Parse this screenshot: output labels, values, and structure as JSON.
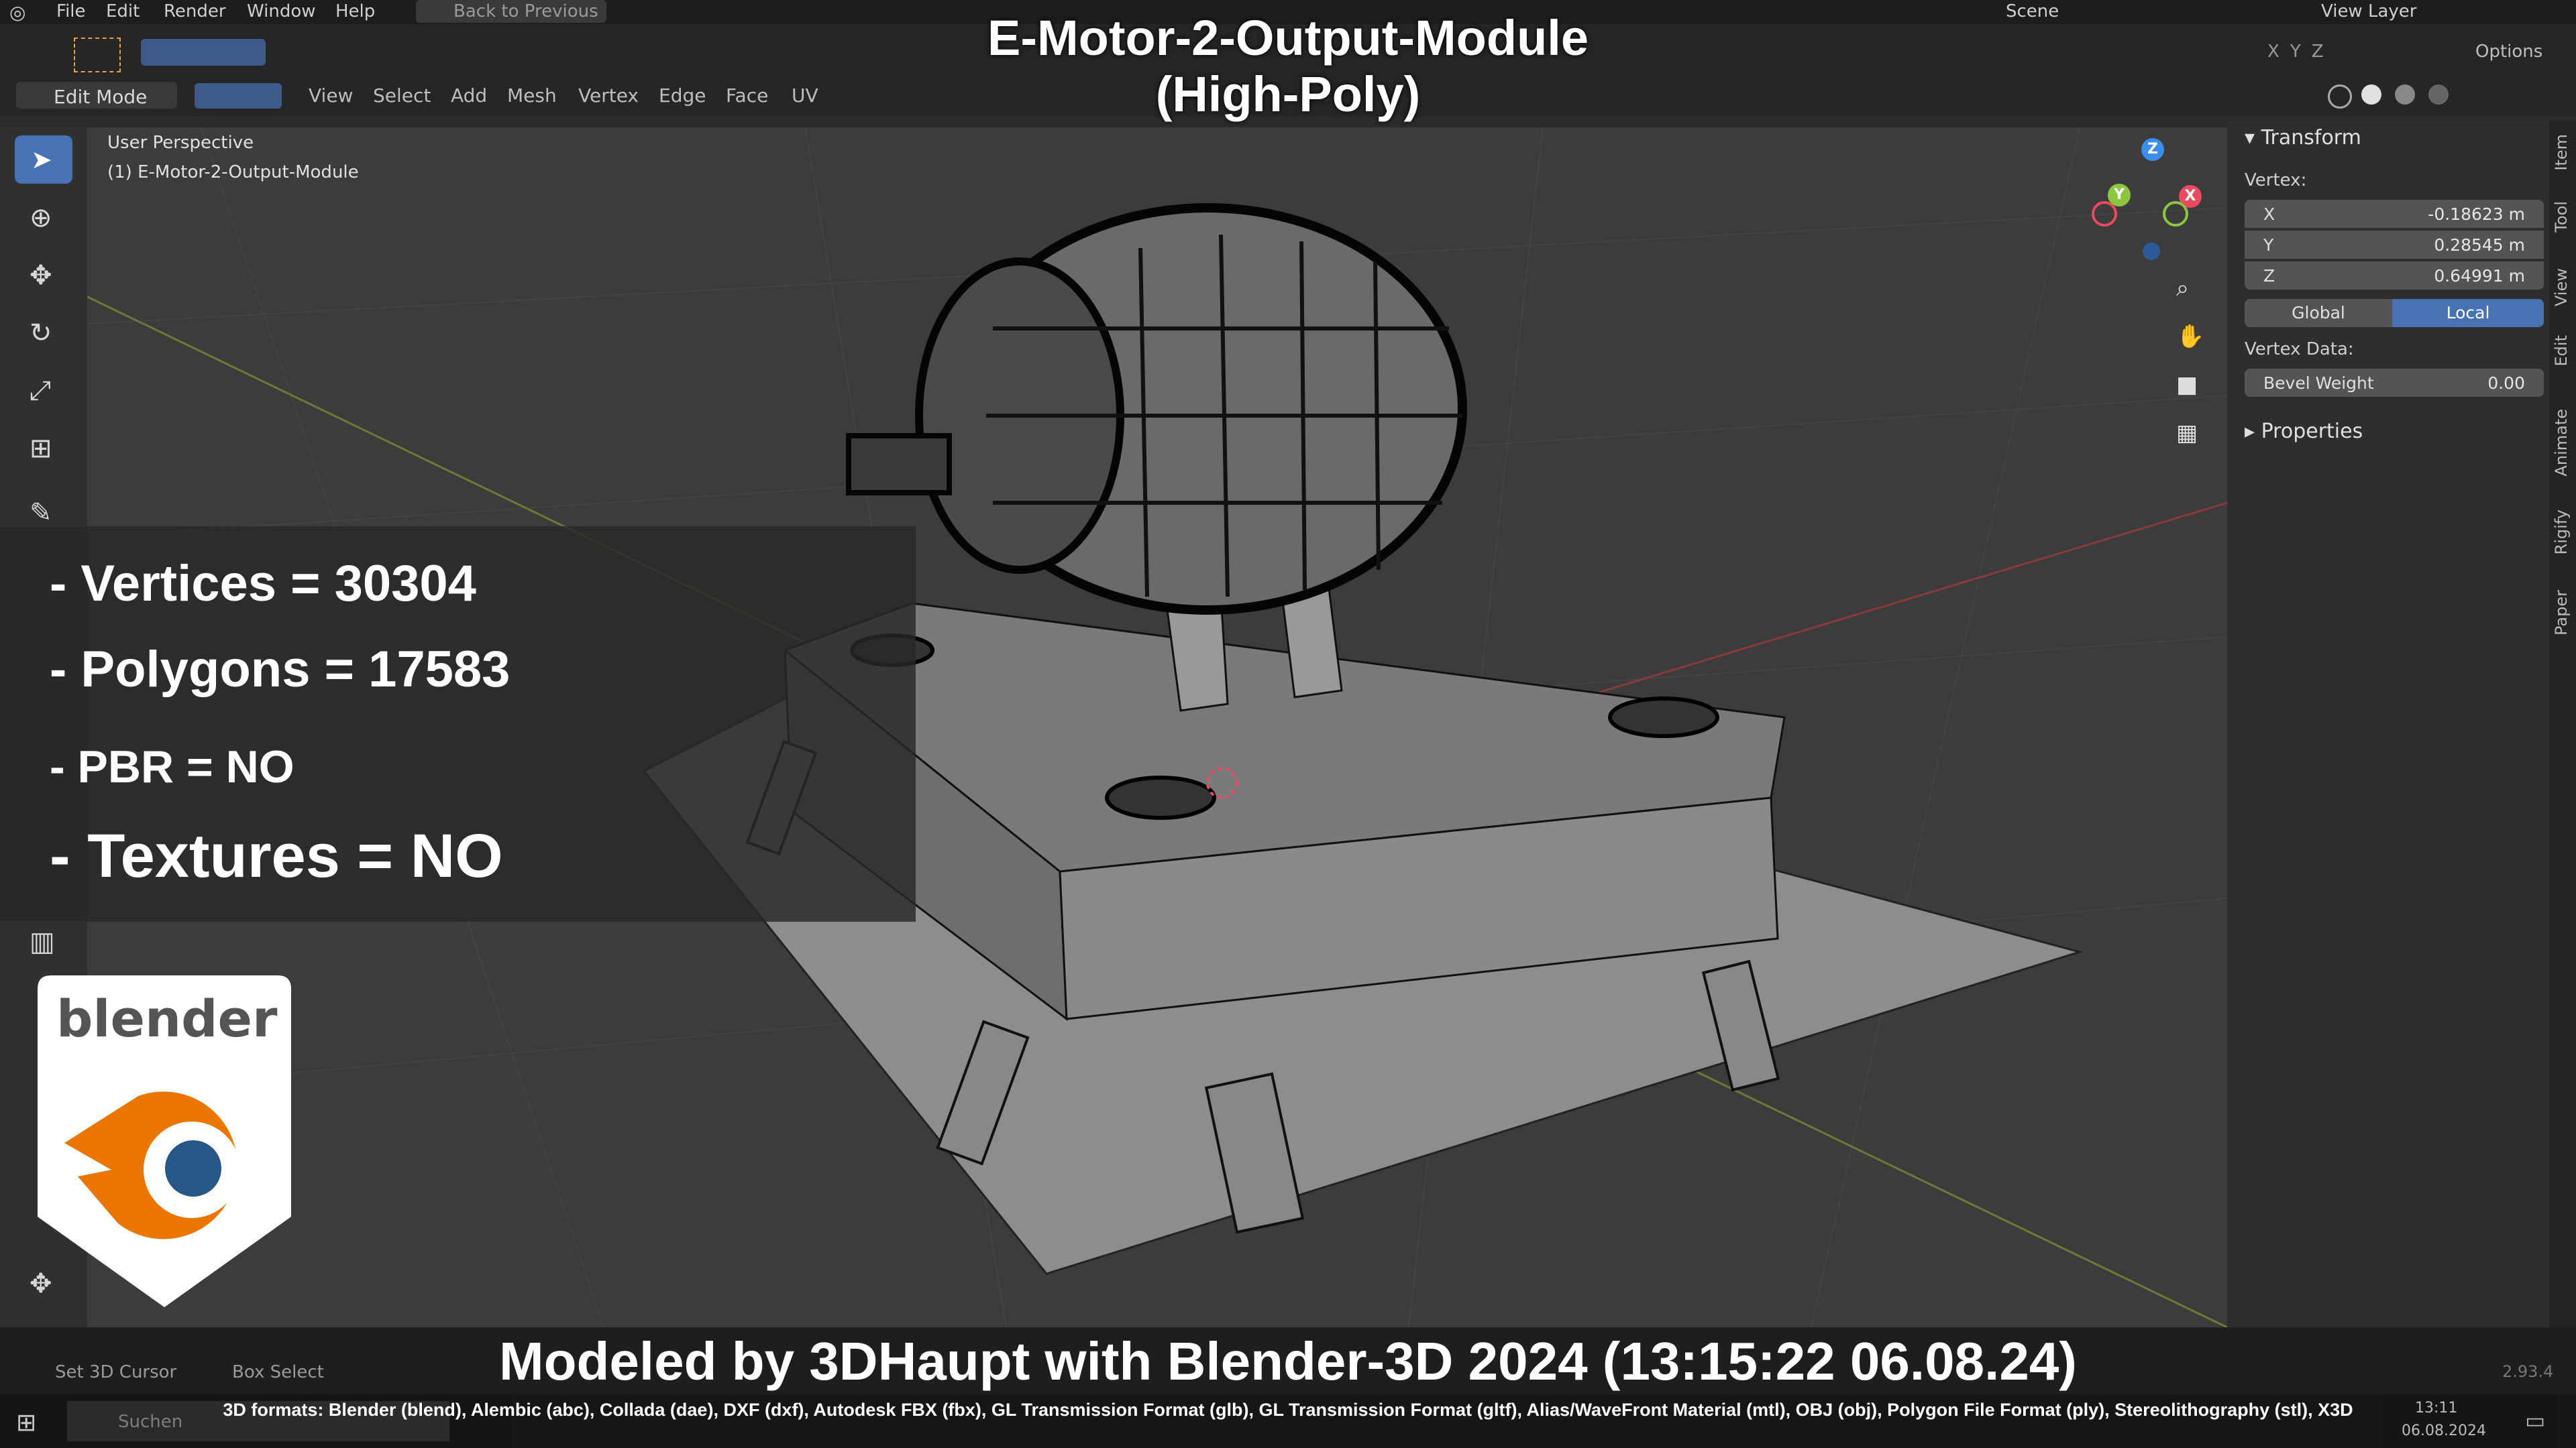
{
  "menubar": {
    "items": [
      "File",
      "Edit",
      "Render",
      "Window",
      "Help"
    ],
    "back_button": "Back to Previous",
    "scene_label": "Scene",
    "view_layer_label": "View Layer"
  },
  "header": {
    "mode": "Edit Mode",
    "menus": [
      "View",
      "Select",
      "Add",
      "Mesh",
      "Vertex",
      "Edge",
      "Face",
      "UV"
    ],
    "options_label": "Options",
    "axis_labels": [
      "X",
      "Y",
      "Z"
    ]
  },
  "viewport": {
    "perspective_label": "User Perspective",
    "object_label": "(1) E-Motor-2-Output-Module"
  },
  "title": {
    "line1": "E-Motor-2-Output-Module",
    "line2": "(High-Poly)"
  },
  "stats": {
    "vertices": "- Vertices = 30304",
    "polygons": "- Polygons = 17583",
    "pbr": "- PBR =  NO",
    "textures": "- Textures = NO"
  },
  "logo": {
    "text": "blender"
  },
  "npanel": {
    "transform_header": "Transform",
    "vertex_label": "Vertex:",
    "x_label": "X",
    "x_value": "-0.18623 m",
    "y_label": "Y",
    "y_value": "0.28545 m",
    "z_label": "Z",
    "z_value": "0.64991 m",
    "global_label": "Global",
    "local_label": "Local",
    "vertex_data_label": "Vertex Data:",
    "bevel_label": "Bevel Weight",
    "bevel_value": "0.00",
    "properties_header": "Properties",
    "tabs": [
      "Item",
      "Tool",
      "View",
      "Edit",
      "Animate",
      "Rigify",
      "Paper"
    ]
  },
  "gizmo": {
    "x": "X",
    "y": "Y",
    "z": "Z"
  },
  "statusbar": {
    "set_cursor": "Set 3D Cursor",
    "box_select": "Box Select",
    "version": "2.93.4"
  },
  "credit": "Modeled by 3DHaupt with Blender-3D 2024 (13:15:22  06.08.24)",
  "formats": "3D formats: Blender (blend), Alembic (abc), Collada (dae), DXF (dxf), Autodesk FBX (fbx), GL Transmission Format (glb), GL Transmission Format (gltf), Alias/WaveFront Material (mtl), OBJ (obj), Polygon File Format (ply), Stereolithography (stl), X3D",
  "taskbar": {
    "search_placeholder": "Suchen",
    "time": "13:11",
    "date": "06.08.2024"
  },
  "colors": {
    "accent_blue": "#4772b3",
    "axis_x": "#e84a5f",
    "axis_y": "#8cc63f",
    "axis_z": "#3b8ee8",
    "logo_orange": "#ea7600",
    "logo_blue": "#265787"
  }
}
